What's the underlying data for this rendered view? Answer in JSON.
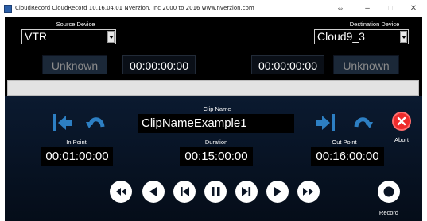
{
  "window": {
    "title": "CloudRecord CloudRecord 10.16.04.01   NVerzion, Inc 2000 to 2016  www.nverzion.com",
    "minimize_glyph": "–",
    "maximize_glyph": "□",
    "close_glyph": "✕",
    "resize_glyph": "⇔"
  },
  "source": {
    "label": "Source Device",
    "selected": "VTR",
    "status": "Unknown",
    "timecode": "00:00:00:00"
  },
  "destination": {
    "label": "Destination Device",
    "selected": "Cloud9_3",
    "status": "Unknown",
    "timecode": "00:00:00:00"
  },
  "clip": {
    "label": "Clip Name",
    "value": "ClipNameExample1"
  },
  "in_point": {
    "label": "In Point",
    "value": "00:01:00:00"
  },
  "duration": {
    "label": "Duration",
    "value": "00:15:00:00"
  },
  "out_point": {
    "label": "Out Point",
    "value": "00:16:00:00"
  },
  "abort": {
    "label": "Abort"
  },
  "record": {
    "label": "Record"
  },
  "colors": {
    "accent_blue": "#2d7fc3",
    "abort_red": "#ee2b2b",
    "background": "#000000",
    "panel": "#0b1a30"
  },
  "icons": {
    "mark_in": "mark-in-icon",
    "goto_in": "goto-in-icon",
    "mark_out": "mark-out-icon",
    "goto_out": "goto-out-icon",
    "abort": "close-icon",
    "transport": [
      "fast-rewind-icon",
      "rewind-icon",
      "skip-back-icon",
      "pause-icon",
      "skip-forward-icon",
      "play-icon",
      "fast-forward-icon"
    ],
    "record": "record-icon"
  }
}
